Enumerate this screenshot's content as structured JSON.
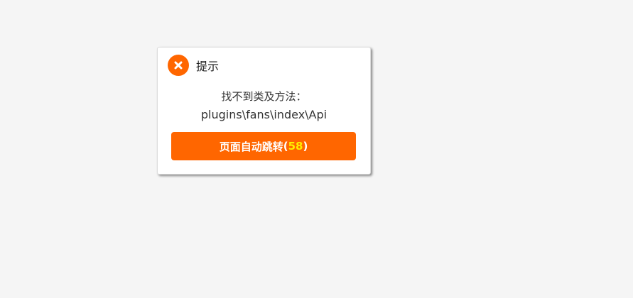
{
  "dialog": {
    "title": "提示",
    "icon": "close-x-icon",
    "message_line1": "找不到类及方法：",
    "message_line2": "plugins\\fans\\index\\Api",
    "button_label": "页面自动跳转",
    "button_open_paren": "(",
    "countdown": "58",
    "button_close_paren": ")"
  },
  "colors": {
    "accent": "#ff6600",
    "countdown": "#ffee00",
    "background": "#f5f5f5"
  }
}
